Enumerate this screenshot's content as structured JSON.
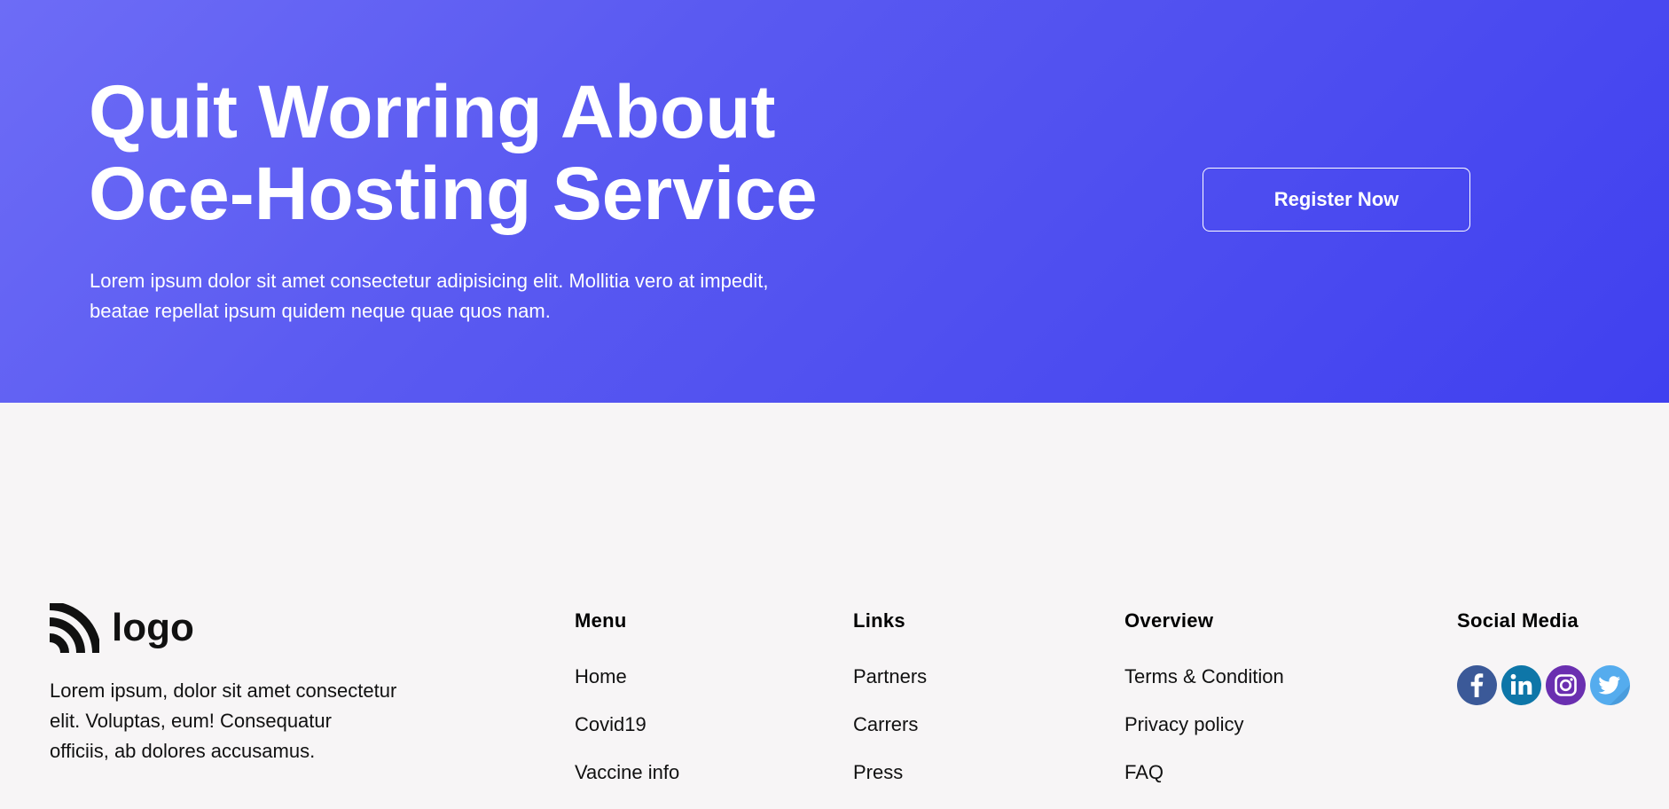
{
  "hero": {
    "title_line1": "Quit Worring About",
    "title_line2": "Oce-Hosting Service",
    "description_line1": "Lorem ipsum dolor sit amet consectetur adipisicing elit. Mollitia vero at impedit,",
    "description_line2": "beatae repellat ipsum quidem neque quae quos nam.",
    "register_label": "Register Now",
    "gradient_colors": [
      "#6d6cf6",
      "#4040ef"
    ]
  },
  "footer": {
    "brand": {
      "logo_text": "logo",
      "logo_icon": "rss-like-arcs-icon",
      "description_lines": [
        "Lorem ipsum, dolor sit amet consectetur",
        "elit. Voluptas, eum! Consequatur",
        "officiis, ab dolores accusamus."
      ]
    },
    "menu": {
      "heading": "Menu",
      "items": [
        "Home",
        "Covid19",
        "Vaccine info"
      ]
    },
    "links": {
      "heading": "Links",
      "items": [
        "Partners",
        "Carrers",
        "Press"
      ]
    },
    "overview": {
      "heading": "Overview",
      "items": [
        "Terms & Condition",
        "Privacy policy",
        "FAQ"
      ]
    },
    "social": {
      "heading": "Social Media",
      "icons": [
        {
          "name": "facebook-icon",
          "color": "#3b5998"
        },
        {
          "name": "linkedin-icon",
          "color": "#0e76a8"
        },
        {
          "name": "instagram-icon",
          "color": "#6a2fb0"
        },
        {
          "name": "twitter-icon",
          "color": "#55acee"
        }
      ]
    }
  }
}
